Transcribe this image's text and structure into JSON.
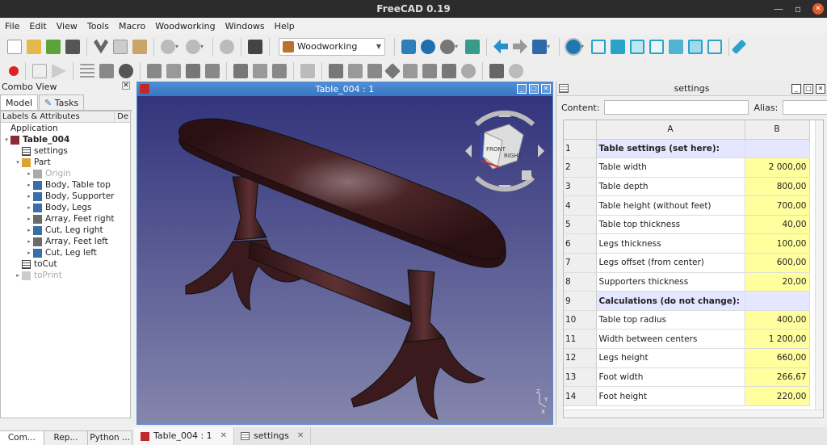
{
  "app": {
    "title": "FreeCAD 0.19"
  },
  "menu": [
    "File",
    "Edit",
    "View",
    "Tools",
    "Macro",
    "Woodworking",
    "Windows",
    "Help"
  ],
  "toolbar": {
    "workbench": "Woodworking"
  },
  "combo": {
    "title": "Combo View",
    "tabs": [
      "Model",
      "Tasks"
    ],
    "tree_header": "Labels & Attributes",
    "tree_header_col2": "De",
    "tree": [
      {
        "label": "Application",
        "depth": 0,
        "arrow": "",
        "icon": "none",
        "bold": false,
        "dim": false
      },
      {
        "label": "Table_004",
        "depth": 0,
        "arrow": "▾",
        "icon": "document-icon",
        "bold": true,
        "dim": false
      },
      {
        "label": "settings",
        "depth": 1,
        "arrow": "",
        "icon": "spreadsheet-icon",
        "bold": false,
        "dim": false
      },
      {
        "label": "Part",
        "depth": 1,
        "arrow": "▾",
        "icon": "part-icon",
        "bold": false,
        "dim": false
      },
      {
        "label": "Origin",
        "depth": 2,
        "arrow": "▸",
        "icon": "origin-icon",
        "bold": false,
        "dim": true
      },
      {
        "label": "Body, Table top",
        "depth": 2,
        "arrow": "▸",
        "icon": "body-icon",
        "bold": false,
        "dim": false
      },
      {
        "label": "Body, Supporter",
        "depth": 2,
        "arrow": "▸",
        "icon": "body-icon",
        "bold": false,
        "dim": false
      },
      {
        "label": "Body, Legs",
        "depth": 2,
        "arrow": "▸",
        "icon": "body-icon",
        "bold": false,
        "dim": false
      },
      {
        "label": "Array, Feet right",
        "depth": 2,
        "arrow": "▸",
        "icon": "array-icon",
        "bold": false,
        "dim": false
      },
      {
        "label": "Cut, Leg right",
        "depth": 2,
        "arrow": "▸",
        "icon": "cut-icon",
        "bold": false,
        "dim": false
      },
      {
        "label": "Array, Feet left",
        "depth": 2,
        "arrow": "▸",
        "icon": "array-icon",
        "bold": false,
        "dim": false
      },
      {
        "label": "Cut, Leg left",
        "depth": 2,
        "arrow": "▸",
        "icon": "cut-icon",
        "bold": false,
        "dim": false
      },
      {
        "label": "toCut",
        "depth": 1,
        "arrow": "",
        "icon": "spreadsheet-icon",
        "bold": false,
        "dim": false
      },
      {
        "label": "toPrint",
        "depth": 1,
        "arrow": "▸",
        "icon": "page-icon",
        "bold": false,
        "dim": true
      }
    ],
    "bottom_tabs": [
      "Com...",
      "Rep...",
      "Python ..."
    ]
  },
  "view": {
    "title": "Table_004 : 1",
    "navcube_front": "FRONT",
    "navcube_right": "RIGHT",
    "axis_labels": [
      "Z",
      "X",
      "Y"
    ]
  },
  "sheet": {
    "title": "settings",
    "content_label": "Content:",
    "alias_label": "Alias:",
    "col_a": "A",
    "col_b": "B",
    "rows": [
      {
        "n": "1",
        "a": "Table settings (set here):",
        "b": "",
        "type": "header"
      },
      {
        "n": "2",
        "a": "Table width",
        "b": "2 000,00",
        "type": "value"
      },
      {
        "n": "3",
        "a": "Table depth",
        "b": "800,00",
        "type": "value"
      },
      {
        "n": "4",
        "a": "Table height (without feet)",
        "b": "700,00",
        "type": "value"
      },
      {
        "n": "5",
        "a": "Table top thickness",
        "b": "40,00",
        "type": "value"
      },
      {
        "n": "6",
        "a": "Legs thickness",
        "b": "100,00",
        "type": "value"
      },
      {
        "n": "7",
        "a": "Legs offset (from center)",
        "b": "600,00",
        "type": "value"
      },
      {
        "n": "8",
        "a": "Supporters thickness",
        "b": "20,00",
        "type": "value"
      },
      {
        "n": "9",
        "a": "Calculations (do not change):",
        "b": "",
        "type": "header"
      },
      {
        "n": "10",
        "a": "Table top radius",
        "b": "400,00",
        "type": "value"
      },
      {
        "n": "11",
        "a": "Width between centers",
        "b": "1 200,00",
        "type": "value"
      },
      {
        "n": "12",
        "a": "Legs height",
        "b": "660,00",
        "type": "value"
      },
      {
        "n": "13",
        "a": "Foot width",
        "b": "266,67",
        "type": "value"
      },
      {
        "n": "14",
        "a": "Foot height",
        "b": "220,00",
        "type": "value"
      }
    ]
  },
  "doc_tabs": [
    {
      "label": "Table_004 : 1",
      "active": true
    },
    {
      "label": "settings",
      "active": false
    }
  ],
  "colors": {
    "accent": "#3a76c2",
    "wood": "#3b1a1c",
    "cell_yellow": "#ffff9e",
    "cell_header": "#e5e6ff"
  }
}
